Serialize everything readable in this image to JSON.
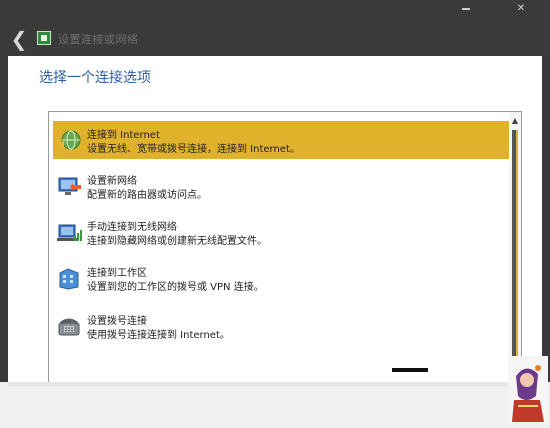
{
  "window": {
    "title": "设置连接或网络",
    "back_icon": "chevron-left-icon",
    "app_icon": "network-setup-icon",
    "minimize_icon": "minimize-icon",
    "close_icon": "close-icon"
  },
  "main": {
    "heading": "选择一个连接选项"
  },
  "options": [
    {
      "title": "连接到 Internet",
      "description": "设置无线、宽带或拨号连接，连接到 Internet。",
      "icon": "globe-connect-icon",
      "selected": true
    },
    {
      "title": "设置新网络",
      "description": "配置新的路由器或访问点。",
      "icon": "new-network-icon",
      "selected": false
    },
    {
      "title": "手动连接到无线网络",
      "description": "连接到隐藏网络或创建新无线配置文件。",
      "icon": "wireless-network-icon",
      "selected": false
    },
    {
      "title": "连接到工作区",
      "description": "设置到您的工作区的拨号或 VPN 连接。",
      "icon": "workplace-icon",
      "selected": false
    },
    {
      "title": "设置拨号连接",
      "description": "使用拨号连接连接到 Internet。",
      "icon": "dialup-phone-icon",
      "selected": false
    }
  ],
  "colors": {
    "selected_background": "#e0b22c",
    "heading": "#2d5ea8",
    "titlebar": "#3b3b3b"
  }
}
